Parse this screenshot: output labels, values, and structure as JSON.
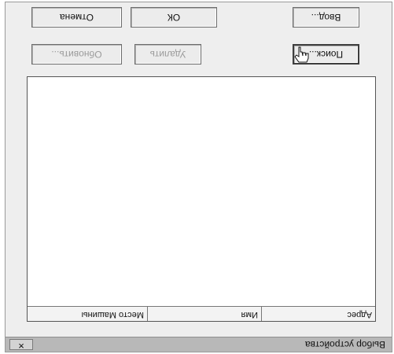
{
  "window": {
    "title": "Выбор устройства",
    "close_label": "✕"
  },
  "list": {
    "columns": [
      "Адрес",
      "Имя",
      "Место Машины"
    ]
  },
  "buttons": {
    "search": "Поиск...",
    "delete": "Удалить",
    "update": "Обновить...",
    "enter": "Ввод...",
    "ok": "ОК",
    "cancel": "Отмена"
  },
  "cursor_icon": "hand-pointer-icon"
}
